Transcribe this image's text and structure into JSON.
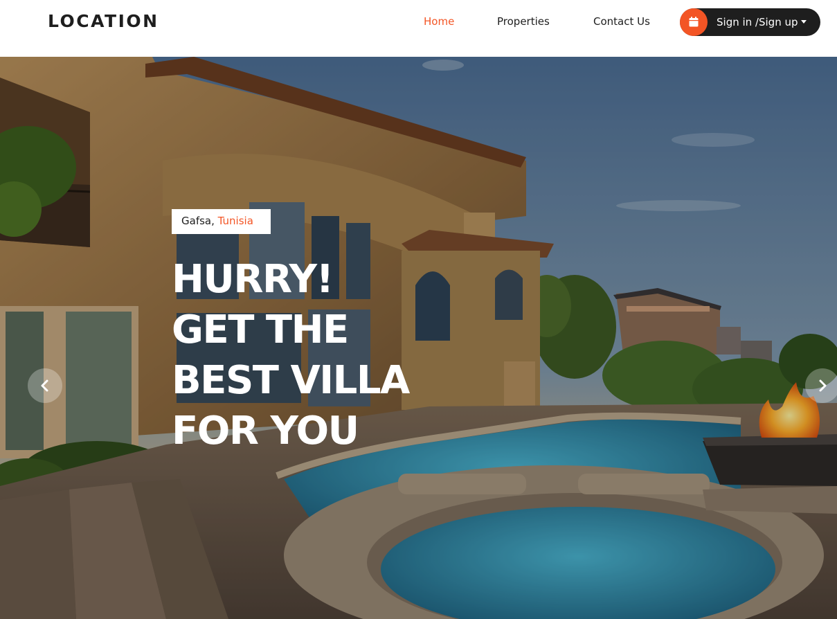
{
  "header": {
    "logo": "LOCATION",
    "nav": [
      {
        "label": "Home",
        "active": true
      },
      {
        "label": "Properties",
        "active": false
      },
      {
        "label": "Contact Us",
        "active": false
      }
    ],
    "signin_label": "Sign in /Sign up",
    "signin_icon": "calendar-icon"
  },
  "hero": {
    "city": "Gafsa,",
    "country": "Tunisia",
    "headline": [
      "HURRY!",
      "GET THE",
      "BEST VILLA",
      "FOR YOU"
    ],
    "prev_icon": "chevron-left-icon",
    "next_icon": "chevron-right-icon"
  },
  "colors": {
    "accent": "#f35525",
    "dark": "#1e1e1e",
    "white": "#ffffff"
  }
}
